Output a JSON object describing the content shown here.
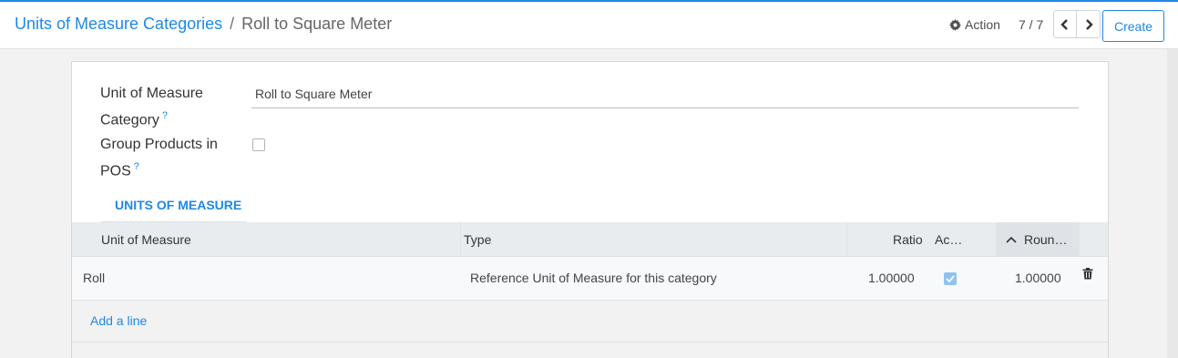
{
  "breadcrumb": {
    "parent": "Units of Measure Categories",
    "separator": "/",
    "current": "Roll to Square Meter"
  },
  "toolbar": {
    "action_label": "Action",
    "pager_value": "7 / 7",
    "create_label": "Create"
  },
  "form": {
    "category_label_line1": "Unit of Measure",
    "category_label_line2": "Category",
    "category_value": "Roll to Square Meter",
    "group_label_line1": "Group Products in",
    "group_label_line2": "POS",
    "group_checked": false,
    "help_mark": "?"
  },
  "tab": {
    "label": "UNITS OF MEASURE"
  },
  "table": {
    "columns": {
      "uom": "Unit of Measure",
      "type": "Type",
      "ratio": "Ratio",
      "active": "Ac…",
      "rounding": "Roun…"
    },
    "sorted_column": "rounding",
    "rows": [
      {
        "uom": "Roll",
        "type": "Reference Unit of Measure for this category",
        "ratio": "1.00000",
        "active": true,
        "rounding": "1.00000"
      }
    ],
    "add_line_label": "Add a line"
  },
  "colors": {
    "accent": "#1e88e5",
    "header_bg": "#e9ecef",
    "checkbox_checked": "#90c2f0"
  },
  "icons": [
    "gear-icon",
    "chevron-left-icon",
    "chevron-right-icon",
    "help-icon",
    "sort-up-icon",
    "check-icon",
    "trash-icon"
  ]
}
